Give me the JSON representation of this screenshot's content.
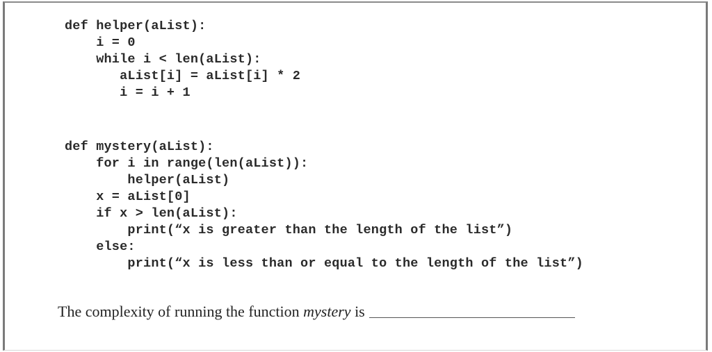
{
  "code": {
    "helper": [
      "def helper(aList):",
      "    i = 0",
      "    while i < len(aList):",
      "       aList[i] = aList[i] * 2",
      "       i = i + 1"
    ],
    "mystery": [
      "def mystery(aList):",
      "    for i in range(len(aList)):",
      "        helper(aList)",
      "    x = aList[0]",
      "    if x > len(aList):",
      "        print(“x is greater than the length of the list”)",
      "    else:",
      "        print(“x is less than or equal to the length of the list”)"
    ]
  },
  "question": {
    "prefix": "The complexity of running the function ",
    "emphasis": "mystery",
    "suffix": " is",
    "answer": ""
  }
}
